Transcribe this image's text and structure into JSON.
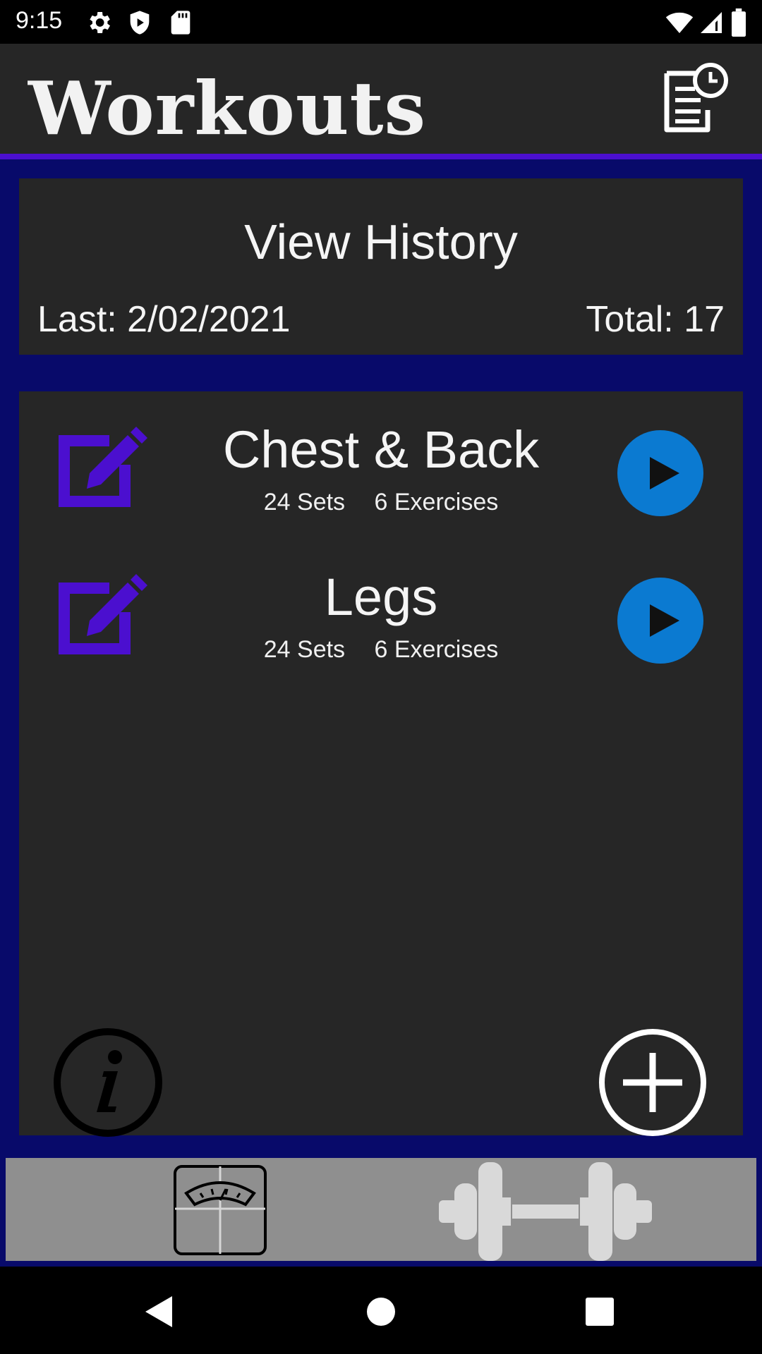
{
  "status_bar": {
    "time": "9:15",
    "left_icons": [
      "gear-icon",
      "shield-icon",
      "sd-card-icon"
    ],
    "right_icons": [
      "wifi-icon",
      "signal-icon",
      "battery-icon"
    ]
  },
  "app_bar": {
    "title": "Workouts",
    "action_icon": "history-clipboard-icon"
  },
  "history_card": {
    "title": "View History",
    "last": "Last: 2/02/2021",
    "total": "Total: 17"
  },
  "workouts": [
    {
      "name": "Chest & Back",
      "sets": "24 Sets",
      "exercises": "6 Exercises"
    },
    {
      "name": "Legs",
      "sets": "24 Sets",
      "exercises": "6 Exercises"
    }
  ],
  "actions": {
    "info_icon": "info-icon",
    "add_icon": "add-icon"
  },
  "bottom_nav": {
    "items": [
      "scale-icon",
      "dumbbell-icon"
    ]
  },
  "colors": {
    "accent": "#4b0fcf",
    "play": "#0b7ad1",
    "background": "#080a6a",
    "card": "#262626",
    "nav": "#8f8f8f"
  }
}
